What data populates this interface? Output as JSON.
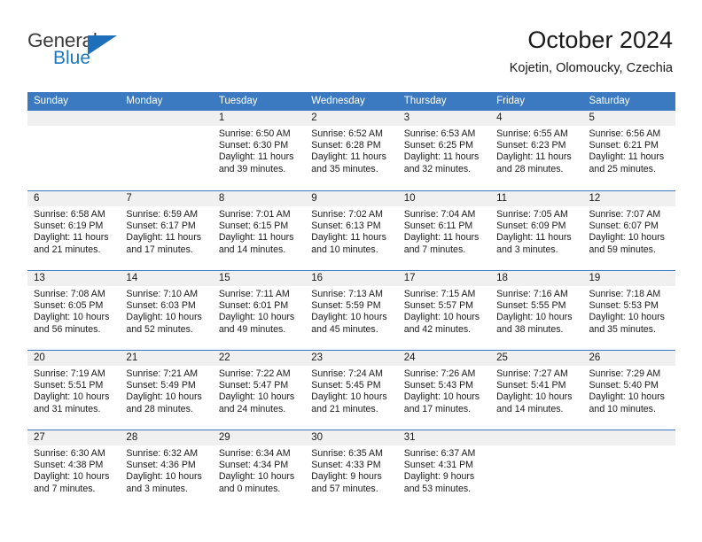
{
  "brand": {
    "name_top": "General",
    "name_bottom": "Blue",
    "color_top": "#3b3b3b",
    "color_bottom": "#1c78c0",
    "triangle_color": "#1c6fb8"
  },
  "header": {
    "title": "October 2024",
    "subtitle": "Kojetin, Olomoucky, Czechia"
  },
  "theme": {
    "header_blue": "#3b7ac0",
    "day_strip_gray": "#f0f0f0",
    "text": "#1a1a1a"
  },
  "weekdays": [
    "Sunday",
    "Monday",
    "Tuesday",
    "Wednesday",
    "Thursday",
    "Friday",
    "Saturday"
  ],
  "weeks": [
    [
      {
        "day": "",
        "sunrise": "",
        "sunset": "",
        "daylight_1": "",
        "daylight_2": "",
        "empty": true
      },
      {
        "day": "",
        "sunrise": "",
        "sunset": "",
        "daylight_1": "",
        "daylight_2": "",
        "empty": true
      },
      {
        "day": "1",
        "sunrise": "Sunrise: 6:50 AM",
        "sunset": "Sunset: 6:30 PM",
        "daylight_1": "Daylight: 11 hours",
        "daylight_2": "and 39 minutes."
      },
      {
        "day": "2",
        "sunrise": "Sunrise: 6:52 AM",
        "sunset": "Sunset: 6:28 PM",
        "daylight_1": "Daylight: 11 hours",
        "daylight_2": "and 35 minutes."
      },
      {
        "day": "3",
        "sunrise": "Sunrise: 6:53 AM",
        "sunset": "Sunset: 6:25 PM",
        "daylight_1": "Daylight: 11 hours",
        "daylight_2": "and 32 minutes."
      },
      {
        "day": "4",
        "sunrise": "Sunrise: 6:55 AM",
        "sunset": "Sunset: 6:23 PM",
        "daylight_1": "Daylight: 11 hours",
        "daylight_2": "and 28 minutes."
      },
      {
        "day": "5",
        "sunrise": "Sunrise: 6:56 AM",
        "sunset": "Sunset: 6:21 PM",
        "daylight_1": "Daylight: 11 hours",
        "daylight_2": "and 25 minutes."
      }
    ],
    [
      {
        "day": "6",
        "sunrise": "Sunrise: 6:58 AM",
        "sunset": "Sunset: 6:19 PM",
        "daylight_1": "Daylight: 11 hours",
        "daylight_2": "and 21 minutes."
      },
      {
        "day": "7",
        "sunrise": "Sunrise: 6:59 AM",
        "sunset": "Sunset: 6:17 PM",
        "daylight_1": "Daylight: 11 hours",
        "daylight_2": "and 17 minutes."
      },
      {
        "day": "8",
        "sunrise": "Sunrise: 7:01 AM",
        "sunset": "Sunset: 6:15 PM",
        "daylight_1": "Daylight: 11 hours",
        "daylight_2": "and 14 minutes."
      },
      {
        "day": "9",
        "sunrise": "Sunrise: 7:02 AM",
        "sunset": "Sunset: 6:13 PM",
        "daylight_1": "Daylight: 11 hours",
        "daylight_2": "and 10 minutes."
      },
      {
        "day": "10",
        "sunrise": "Sunrise: 7:04 AM",
        "sunset": "Sunset: 6:11 PM",
        "daylight_1": "Daylight: 11 hours",
        "daylight_2": "and 7 minutes."
      },
      {
        "day": "11",
        "sunrise": "Sunrise: 7:05 AM",
        "sunset": "Sunset: 6:09 PM",
        "daylight_1": "Daylight: 11 hours",
        "daylight_2": "and 3 minutes."
      },
      {
        "day": "12",
        "sunrise": "Sunrise: 7:07 AM",
        "sunset": "Sunset: 6:07 PM",
        "daylight_1": "Daylight: 10 hours",
        "daylight_2": "and 59 minutes."
      }
    ],
    [
      {
        "day": "13",
        "sunrise": "Sunrise: 7:08 AM",
        "sunset": "Sunset: 6:05 PM",
        "daylight_1": "Daylight: 10 hours",
        "daylight_2": "and 56 minutes."
      },
      {
        "day": "14",
        "sunrise": "Sunrise: 7:10 AM",
        "sunset": "Sunset: 6:03 PM",
        "daylight_1": "Daylight: 10 hours",
        "daylight_2": "and 52 minutes."
      },
      {
        "day": "15",
        "sunrise": "Sunrise: 7:11 AM",
        "sunset": "Sunset: 6:01 PM",
        "daylight_1": "Daylight: 10 hours",
        "daylight_2": "and 49 minutes."
      },
      {
        "day": "16",
        "sunrise": "Sunrise: 7:13 AM",
        "sunset": "Sunset: 5:59 PM",
        "daylight_1": "Daylight: 10 hours",
        "daylight_2": "and 45 minutes."
      },
      {
        "day": "17",
        "sunrise": "Sunrise: 7:15 AM",
        "sunset": "Sunset: 5:57 PM",
        "daylight_1": "Daylight: 10 hours",
        "daylight_2": "and 42 minutes."
      },
      {
        "day": "18",
        "sunrise": "Sunrise: 7:16 AM",
        "sunset": "Sunset: 5:55 PM",
        "daylight_1": "Daylight: 10 hours",
        "daylight_2": "and 38 minutes."
      },
      {
        "day": "19",
        "sunrise": "Sunrise: 7:18 AM",
        "sunset": "Sunset: 5:53 PM",
        "daylight_1": "Daylight: 10 hours",
        "daylight_2": "and 35 minutes."
      }
    ],
    [
      {
        "day": "20",
        "sunrise": "Sunrise: 7:19 AM",
        "sunset": "Sunset: 5:51 PM",
        "daylight_1": "Daylight: 10 hours",
        "daylight_2": "and 31 minutes."
      },
      {
        "day": "21",
        "sunrise": "Sunrise: 7:21 AM",
        "sunset": "Sunset: 5:49 PM",
        "daylight_1": "Daylight: 10 hours",
        "daylight_2": "and 28 minutes."
      },
      {
        "day": "22",
        "sunrise": "Sunrise: 7:22 AM",
        "sunset": "Sunset: 5:47 PM",
        "daylight_1": "Daylight: 10 hours",
        "daylight_2": "and 24 minutes."
      },
      {
        "day": "23",
        "sunrise": "Sunrise: 7:24 AM",
        "sunset": "Sunset: 5:45 PM",
        "daylight_1": "Daylight: 10 hours",
        "daylight_2": "and 21 minutes."
      },
      {
        "day": "24",
        "sunrise": "Sunrise: 7:26 AM",
        "sunset": "Sunset: 5:43 PM",
        "daylight_1": "Daylight: 10 hours",
        "daylight_2": "and 17 minutes."
      },
      {
        "day": "25",
        "sunrise": "Sunrise: 7:27 AM",
        "sunset": "Sunset: 5:41 PM",
        "daylight_1": "Daylight: 10 hours",
        "daylight_2": "and 14 minutes."
      },
      {
        "day": "26",
        "sunrise": "Sunrise: 7:29 AM",
        "sunset": "Sunset: 5:40 PM",
        "daylight_1": "Daylight: 10 hours",
        "daylight_2": "and 10 minutes."
      }
    ],
    [
      {
        "day": "27",
        "sunrise": "Sunrise: 6:30 AM",
        "sunset": "Sunset: 4:38 PM",
        "daylight_1": "Daylight: 10 hours",
        "daylight_2": "and 7 minutes."
      },
      {
        "day": "28",
        "sunrise": "Sunrise: 6:32 AM",
        "sunset": "Sunset: 4:36 PM",
        "daylight_1": "Daylight: 10 hours",
        "daylight_2": "and 3 minutes."
      },
      {
        "day": "29",
        "sunrise": "Sunrise: 6:34 AM",
        "sunset": "Sunset: 4:34 PM",
        "daylight_1": "Daylight: 10 hours",
        "daylight_2": "and 0 minutes."
      },
      {
        "day": "30",
        "sunrise": "Sunrise: 6:35 AM",
        "sunset": "Sunset: 4:33 PM",
        "daylight_1": "Daylight: 9 hours",
        "daylight_2": "and 57 minutes."
      },
      {
        "day": "31",
        "sunrise": "Sunrise: 6:37 AM",
        "sunset": "Sunset: 4:31 PM",
        "daylight_1": "Daylight: 9 hours",
        "daylight_2": "and 53 minutes."
      },
      {
        "day": "",
        "sunrise": "",
        "sunset": "",
        "daylight_1": "",
        "daylight_2": "",
        "empty": true
      },
      {
        "day": "",
        "sunrise": "",
        "sunset": "",
        "daylight_1": "",
        "daylight_2": "",
        "empty": true
      }
    ]
  ]
}
